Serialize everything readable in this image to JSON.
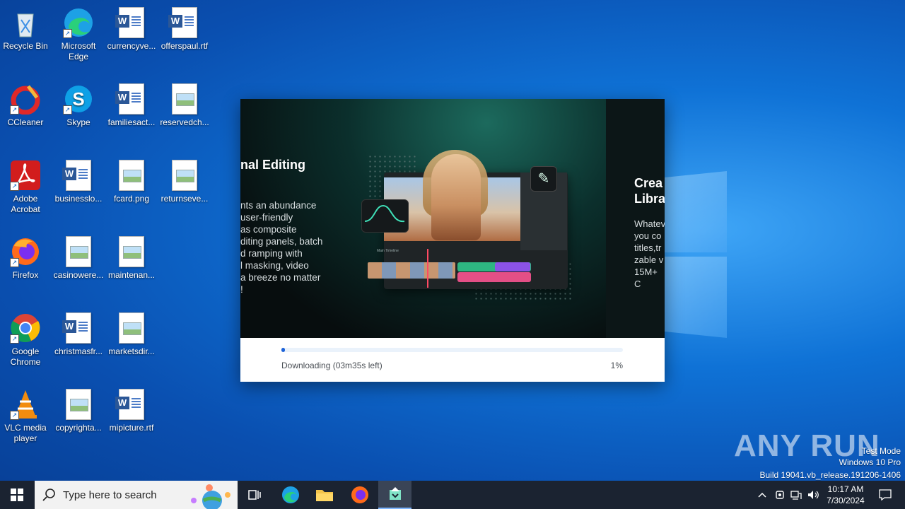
{
  "desktop": {
    "icons": [
      {
        "label": "Recycle Bin"
      },
      {
        "label": "Microsoft Edge"
      },
      {
        "label": "currencyve..."
      },
      {
        "label": "offerspaul.rtf"
      },
      {
        "label": "CCleaner"
      },
      {
        "label": "Skype"
      },
      {
        "label": "familiesact..."
      },
      {
        "label": "reservedch..."
      },
      {
        "label": "Adobe Acrobat"
      },
      {
        "label": "businesslo..."
      },
      {
        "label": "fcard.png"
      },
      {
        "label": "returnseve..."
      },
      {
        "label": "Firefox"
      },
      {
        "label": "casinowere..."
      },
      {
        "label": "maintenan..."
      },
      {
        "label": "Google Chrome"
      },
      {
        "label": "christmasfr..."
      },
      {
        "label": "marketsdir..."
      },
      {
        "label": "VLC media player"
      },
      {
        "label": "copyrighta..."
      },
      {
        "label": "mipicture.rtf"
      }
    ]
  },
  "installer": {
    "slide_left_title": "nal Editing",
    "slide_left_body": "nts an abundance\nuser-friendly\n as composite\nditing panels, batch\nd ramping with\nl masking, video\na breeze no matter\n!",
    "slide_right_title": "Crea\nLibra",
    "slide_right_body": "Whatev\nyou co\ntitles,tr\nzable v\n15M+ C",
    "editor_timeline_label": "Main Timeline",
    "status": "Downloading (03m35s left)",
    "percent": "1%",
    "progress": 0.01
  },
  "watermark": {
    "brand": "ANY RUN",
    "line1": "Test Mode",
    "line2": "Windows 10 Pro",
    "line3": "Build 19041.vb_release.191206-1406"
  },
  "taskbar": {
    "search_placeholder": "Type here to search",
    "time": "10:17 AM",
    "date": "7/30/2024",
    "apps": [
      "task-view",
      "edge",
      "file-explorer",
      "firefox",
      "installer"
    ]
  },
  "colors": {
    "accent": "#1e63d8",
    "taskbar": "#1b2331",
    "desktop": "#0f72d6"
  }
}
